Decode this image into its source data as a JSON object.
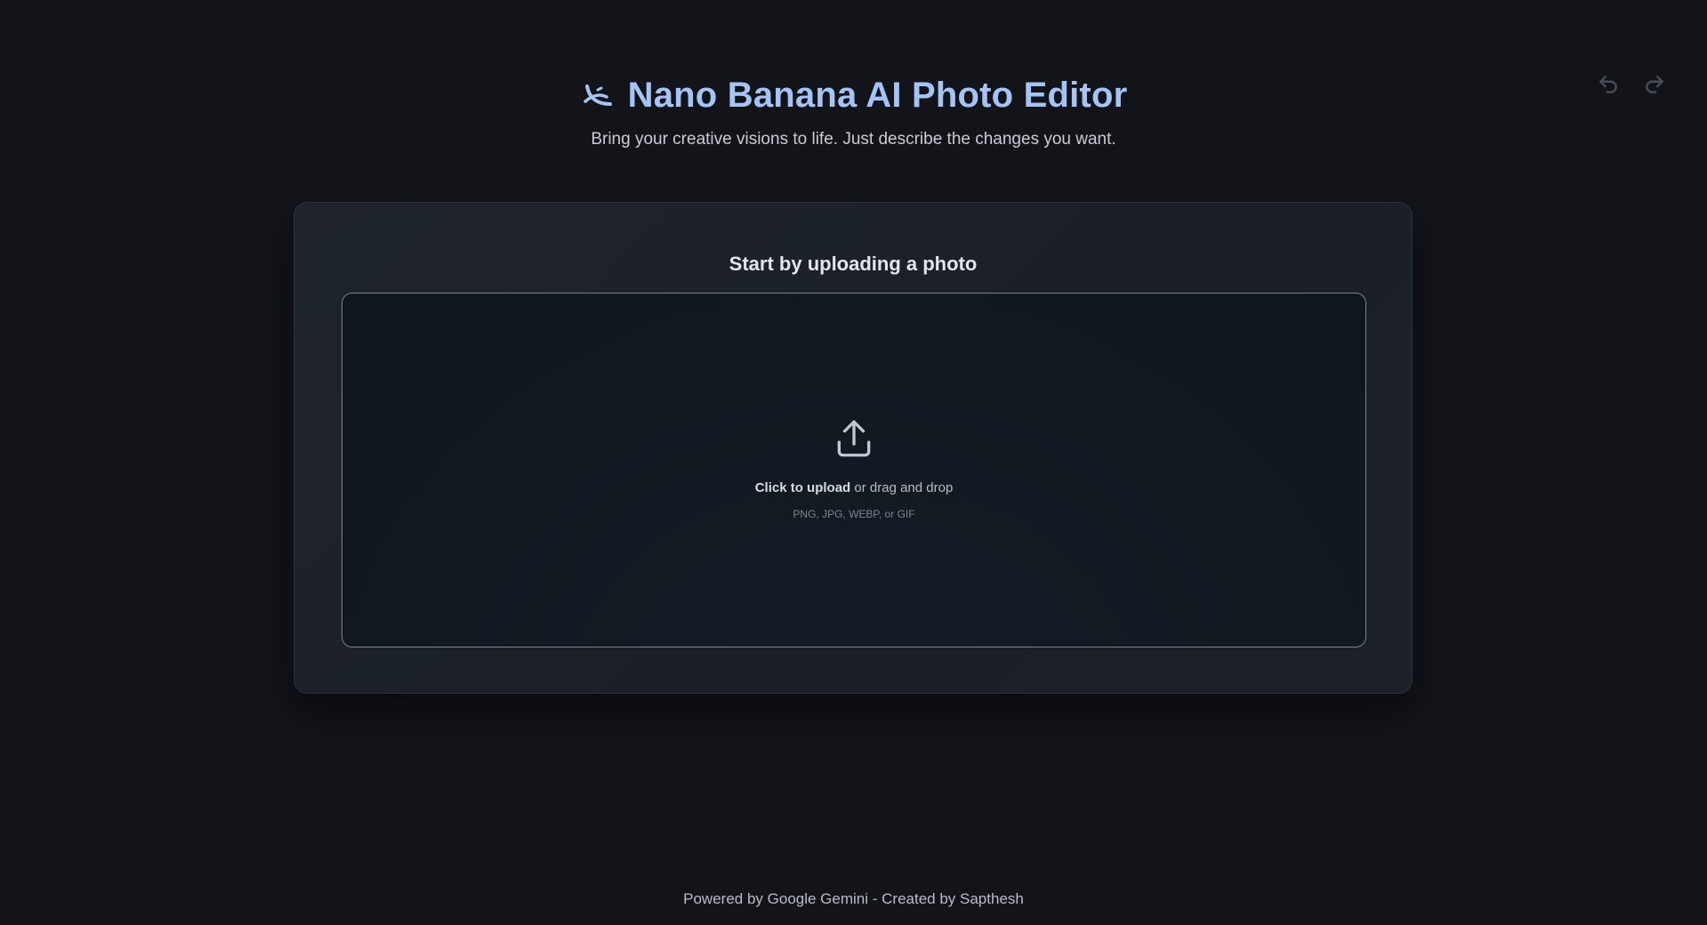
{
  "header": {
    "title": "Nano Banana AI Photo Editor",
    "subtitle": "Bring your creative visions to life. Just describe the changes you want.",
    "logo_icon": "banana-icon"
  },
  "history": {
    "undo_icon": "undo-icon",
    "redo_icon": "redo-icon"
  },
  "upload": {
    "heading": "Start by uploading a photo",
    "action_label": "Click to upload",
    "action_suffix": " or drag and drop",
    "formats": "PNG, JPG, WEBP, or GIF",
    "icon": "upload-icon"
  },
  "footer": {
    "text": "Powered by Google Gemini - Created by Sapthesh"
  },
  "colors": {
    "background": "#12141a",
    "accent": "#a5c3f5",
    "card": "#1f242c",
    "dropzone_border": "#7c828c"
  }
}
